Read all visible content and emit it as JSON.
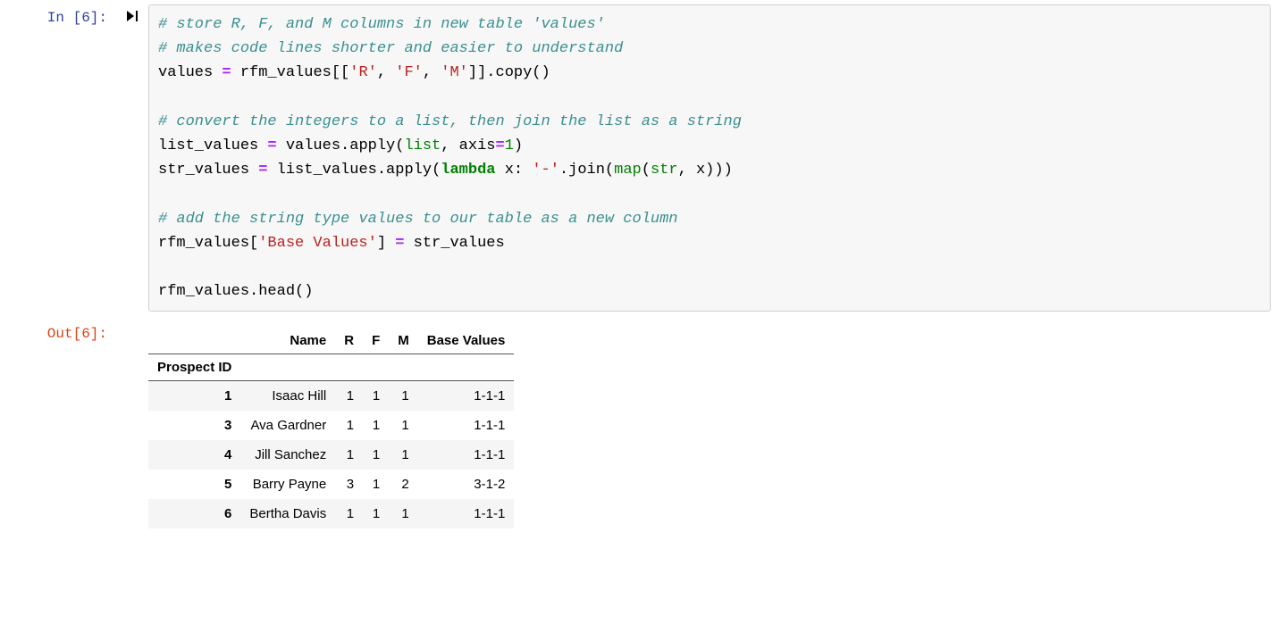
{
  "cell": {
    "input_prompt": "In [6]:",
    "output_prompt": "Out[6]:",
    "run_icon_glyph": "▶|",
    "code": {
      "line1_comment": "# store R, F, and M columns in new table 'values'",
      "line2_comment": "# makes code lines shorter and easier to understand",
      "line3_var": "values",
      "line3_op": " = ",
      "line3_src": "rfm_values[[",
      "line3_str_r": "'R'",
      "line3_sep1": ", ",
      "line3_str_f": "'F'",
      "line3_sep2": ", ",
      "line3_str_m": "'M'",
      "line3_tail": "]].copy()",
      "blank": "",
      "line5_comment": "# convert the integers to a list, then join the list as a string",
      "line6_var": "list_values",
      "line6_op": " = ",
      "line6_body_a": "values.apply(",
      "line6_builtin_list": "list",
      "line6_body_b": ", axis",
      "line6_eq": "=",
      "line6_num": "1",
      "line6_close": ")",
      "line7_var": "str_values",
      "line7_op": " = ",
      "line7_body_a": "list_values.apply(",
      "line7_kw_lambda": "lambda",
      "line7_body_b": " x: ",
      "line7_str_dash": "'-'",
      "line7_body_c": ".join(",
      "line7_builtin_map": "map",
      "line7_body_d": "(",
      "line7_builtin_str": "str",
      "line7_body_e": ", x)))",
      "line9_comment": "# add the string type values to our table as a new column",
      "line10_a": "rfm_values[",
      "line10_str": "'Base Values'",
      "line10_b": "]",
      "line10_op": " = ",
      "line10_c": "str_values",
      "line12": "rfm_values.head()"
    }
  },
  "output": {
    "columns": [
      "Name",
      "R",
      "F",
      "M",
      "Base Values"
    ],
    "index_name": "Prospect ID",
    "rows": [
      {
        "idx": "1",
        "name": "Isaac Hill",
        "r": "1",
        "f": "1",
        "m": "1",
        "bv": "1-1-1"
      },
      {
        "idx": "3",
        "name": "Ava Gardner",
        "r": "1",
        "f": "1",
        "m": "1",
        "bv": "1-1-1"
      },
      {
        "idx": "4",
        "name": "Jill Sanchez",
        "r": "1",
        "f": "1",
        "m": "1",
        "bv": "1-1-1"
      },
      {
        "idx": "5",
        "name": "Barry Payne",
        "r": "3",
        "f": "1",
        "m": "2",
        "bv": "3-1-2"
      },
      {
        "idx": "6",
        "name": "Bertha Davis",
        "r": "1",
        "f": "1",
        "m": "1",
        "bv": "1-1-1"
      }
    ]
  }
}
